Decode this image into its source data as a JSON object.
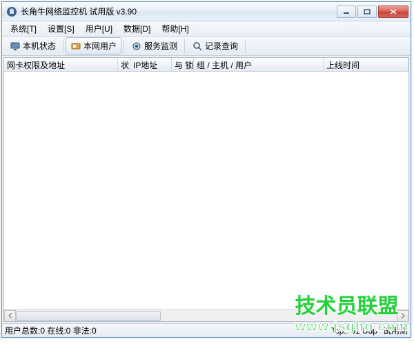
{
  "title": "长角牛网络监控机 试用版 v3.90",
  "menu": {
    "system": "系统[T]",
    "settings": "设置[S]",
    "users": "用户[U]",
    "data": "数据[D]",
    "help": "帮助[H]"
  },
  "toolbar": {
    "localStatus": "本机状态",
    "netUsers": "本网用户",
    "serviceMonitor": "服务监测",
    "logQuery": "记录查询"
  },
  "columns": {
    "nicPermAddr": "网卡权限及地址",
    "ipShort": "状",
    "ipAddr": "IP地址",
    "lockShort": "与 锁",
    "groupHostUser": "组 / 主机 / 用户",
    "onlineTime": "上线时间"
  },
  "status": {
    "userCounts": "用户总数:0 在线:0 非法:0",
    "tcpudp": "Tcp:151 Udp",
    "tail": "试用期"
  },
  "watermark": {
    "cn": "技术员联盟",
    "url": "www.jsgho.com"
  }
}
